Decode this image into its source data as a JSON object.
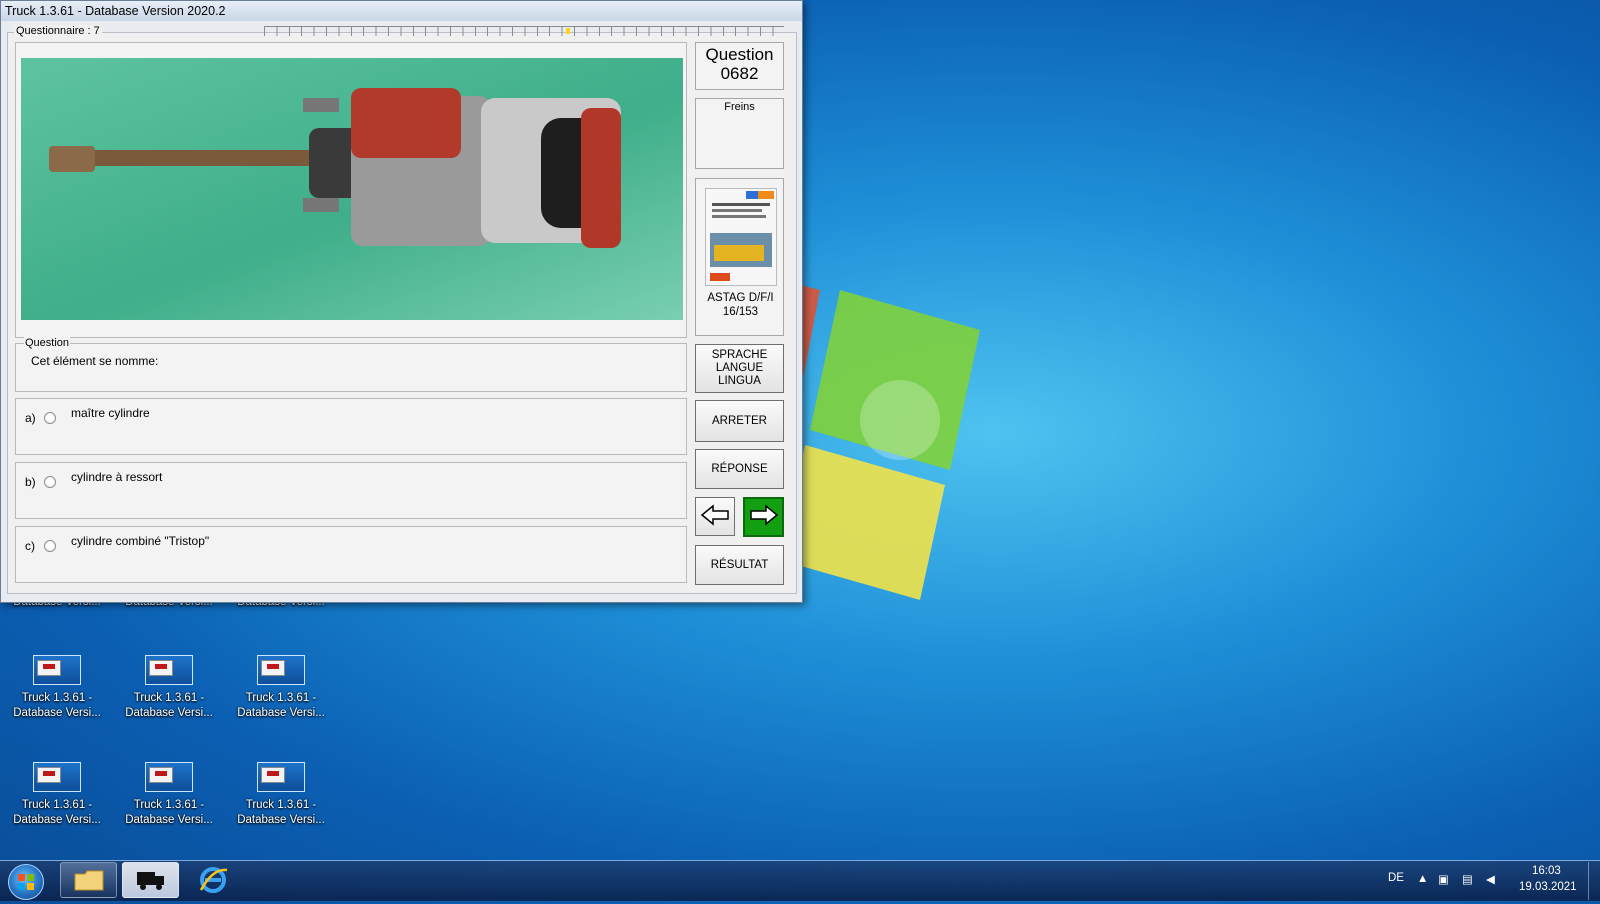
{
  "window": {
    "title": "Truck 1.3.61 - Database Version 2020.2"
  },
  "questionnaire": {
    "label": "Questionnaire : 7"
  },
  "side": {
    "question_title": "Question",
    "question_number": "0682",
    "category": "Freins",
    "book_label_line1": "ASTAG D/F/I",
    "book_label_line2": "16/153"
  },
  "question": {
    "legend": "Question",
    "text": "Cet élément se nomme:"
  },
  "answers": [
    {
      "letter": "a)",
      "text": "maître cylindre"
    },
    {
      "letter": "b)",
      "text": "cylindre à ressort"
    },
    {
      "letter": "c)",
      "text": "cylindre combiné \"Tristop\""
    }
  ],
  "buttons": {
    "language_line1": "SPRACHE",
    "language_line2": "LANGUE",
    "language_line3": "LINGUA",
    "stop": "ARRETER",
    "answer": "RÉPONSE",
    "result": "RÉSULTAT"
  },
  "desktop": {
    "icons": [
      {
        "line1": "",
        "line2": "Database Versi..."
      },
      {
        "line1": "",
        "line2": "Database Versi..."
      },
      {
        "line1": "",
        "line2": "Database Versi..."
      },
      {
        "line1": "Truck 1.3.61 -",
        "line2": "Database Versi..."
      },
      {
        "line1": "Truck 1.3.61 -",
        "line2": "Database Versi..."
      },
      {
        "line1": "Truck 1.3.61 -",
        "line2": "Database Versi..."
      },
      {
        "line1": "Truck 1.3.61 -",
        "line2": "Database Versi..."
      },
      {
        "line1": "Truck 1.3.61 -",
        "line2": "Database Versi..."
      },
      {
        "line1": "Truck 1.3.61 -",
        "line2": "Database Versi..."
      }
    ]
  },
  "taskbar": {
    "language": "DE",
    "time": "16:03",
    "date": "19.03.2021"
  },
  "colors": {
    "next_button": "#12a012",
    "photo_bg": "#4fb894"
  }
}
